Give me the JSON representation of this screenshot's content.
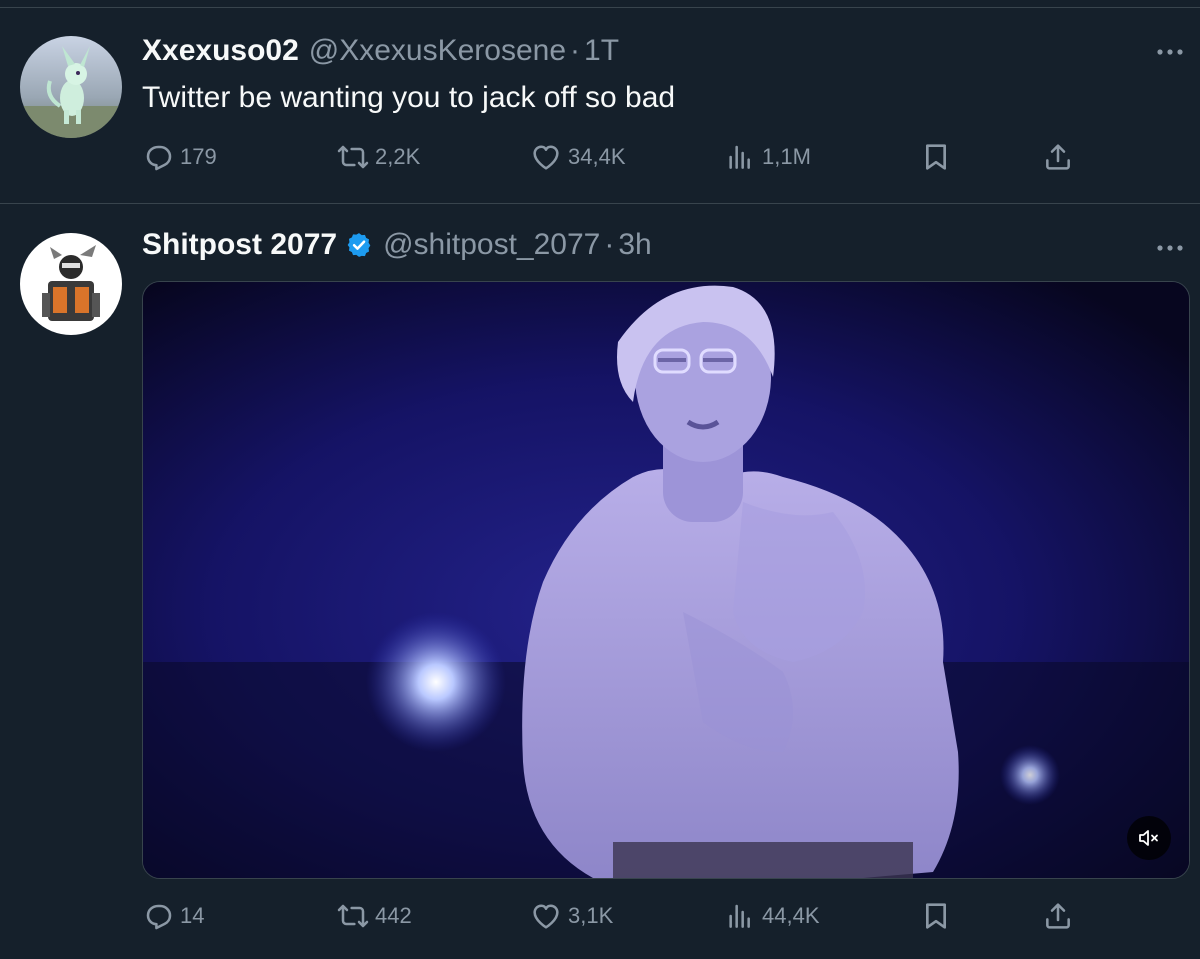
{
  "tweets": [
    {
      "author": "Xxexuso02",
      "handle": "@XxexusKerosene",
      "separator": "·",
      "time": "1T",
      "text": "Twitter be wanting you to jack off so bad",
      "avatar_icon": "espeon-avatar",
      "stats": {
        "replies": "179",
        "retweets": "2,2K",
        "likes": "34,4K",
        "views": "1,1M"
      }
    },
    {
      "author": "Shitpost 2077",
      "handle": "@shitpost_2077",
      "separator": "·",
      "time": "3h",
      "verified": true,
      "avatar_icon": "robot-avatar",
      "media": {
        "type": "video",
        "muted": true
      },
      "stats": {
        "replies": "14",
        "retweets": "442",
        "likes": "3,1K",
        "views": "44,4K"
      }
    }
  ],
  "colors": {
    "background": "#15202b",
    "divider": "#38444d",
    "primary_text": "#f7f9f9",
    "secondary_text": "#8b98a5",
    "verified_blue": "#1d9bf0"
  }
}
